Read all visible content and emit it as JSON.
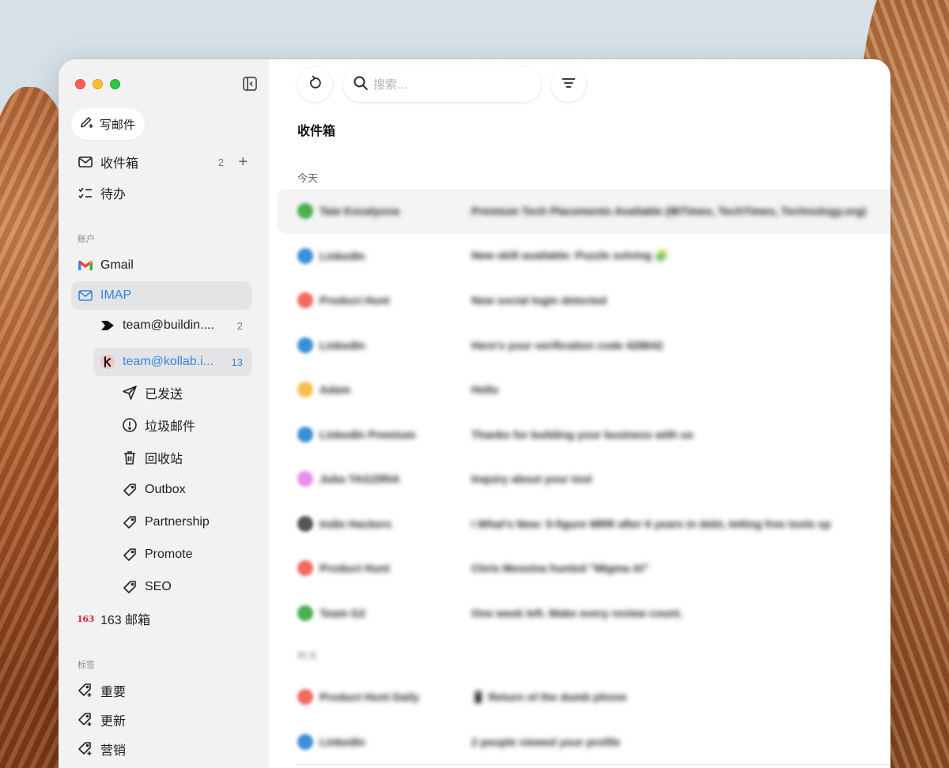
{
  "sidebar": {
    "compose_label": "写邮件",
    "inbox": {
      "label": "收件箱",
      "count": "2",
      "add": "+"
    },
    "todo_label": "待办",
    "accounts_label": "账户",
    "gmail_label": "Gmail",
    "imap_label": "IMAP",
    "imap_accounts": [
      {
        "label": "team@buildin....",
        "count": "2"
      },
      {
        "label": "team@kollab.i...",
        "count": "13"
      }
    ],
    "folders": [
      "已发送",
      "垃圾邮件",
      "回收站",
      "Outbox",
      "Partnership",
      "Promote",
      "SEO"
    ],
    "mail163_icon_text": "163",
    "mail163_label": "163 邮箱",
    "tags_label": "标签",
    "tags": [
      "重要",
      "更新",
      "营销"
    ]
  },
  "toolbar": {
    "search_placeholder": "搜索..."
  },
  "main": {
    "title": "收件箱",
    "group_today": "今天",
    "group_yesterday": "昨天",
    "emails_today": [
      {
        "sender": "Taie Kovalyova",
        "subject": "Premium Tech Placements Available (IBTimes, TechTimes, Technology.org)",
        "color": "#4caf50"
      },
      {
        "sender": "LinkedIn",
        "subject": "New skill available: Puzzle solving 🧩",
        "color": "#3b8fd6"
      },
      {
        "sender": "Product Hunt",
        "subject": "New social login detected",
        "color": "#f06a5e"
      },
      {
        "sender": "LinkedIn",
        "subject": "Here's your verification code 428642",
        "color": "#3b8fd6"
      },
      {
        "sender": "Adam",
        "subject": "Hello",
        "color": "#f4c14d"
      },
      {
        "sender": "LinkedIn Premium",
        "subject": "Thanks for building your business with us",
        "color": "#3b8fd6"
      },
      {
        "sender": "Juba TAGZIRIA",
        "subject": "Inquiry about your tool",
        "color": "#e88ee8"
      },
      {
        "sender": "Indie Hackers",
        "subject": "\\ What's New: 5-figure MRR after 6 years in debt, letting free tools sp",
        "color": "#555555"
      },
      {
        "sender": "Product Hunt",
        "subject": "Chris Messina hunted \"Migma AI\"",
        "color": "#f06a5e"
      },
      {
        "sender": "Team G2",
        "subject": "One week left. Make every review count.",
        "color": "#4caf50"
      }
    ],
    "emails_yesterday": [
      {
        "sender": "Product Hunt Daily",
        "subject": "📱 Return of the dumb phone",
        "color": "#f06a5e"
      },
      {
        "sender": "LinkedIn",
        "subject": "2 people viewed your profile",
        "color": "#3b8fd6"
      }
    ]
  },
  "colors": {
    "accent": "#2e86de",
    "sidebar_bg": "#f2f2f3"
  }
}
